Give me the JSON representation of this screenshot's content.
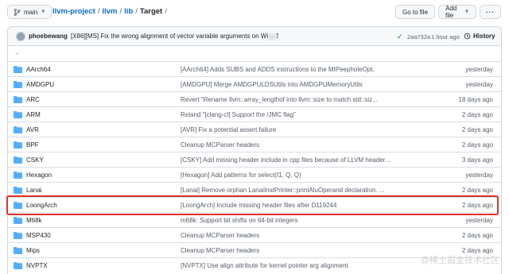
{
  "branch": {
    "label": "main"
  },
  "breadcrumb": {
    "repo": "llvm-project",
    "dir1": "llvm",
    "dir2": "lib",
    "current": "Target",
    "sep": "/"
  },
  "toolbar": {
    "goto_label": "Go to file",
    "add_label": "Add file",
    "more_label": "···"
  },
  "commit": {
    "author": "phoebewang",
    "message": "[X86][MS] Fix the wrong alignment of vector variable arguments on Win32",
    "ellipsis": "...",
    "check": "✓",
    "sha": "2aa732a",
    "time": "1 hour ago",
    "history_label": "History"
  },
  "parent": "..",
  "rows": [
    {
      "name": "AArch64",
      "message": "[AArch64] Adds SUBS and ADDS instructions to the MIPeepholeOpt.",
      "age": "yesterday"
    },
    {
      "name": "AMDGPU",
      "message": "[AMDGPU] Merge AMDGPULDSUtils into AMDGPUMemoryUtils",
      "age": "yesterday"
    },
    {
      "name": "ARC",
      "message": "Revert \"Rename llvm::array_lengthof into llvm::size to match std::siz...",
      "age": "18 days ago"
    },
    {
      "name": "ARM",
      "message": "Reland \"[clang-cl] Support the /JMC flag\"",
      "age": "2 days ago"
    },
    {
      "name": "AVR",
      "message": "[AVR] Fix a potential assert failure",
      "age": "2 days ago"
    },
    {
      "name": "BPF",
      "message": "Cleanup MCParser headers",
      "age": "2 days ago"
    },
    {
      "name": "CSKY",
      "message": "[CSKY] Add missing header include in cpp files because of LLVM header...",
      "age": "3 days ago"
    },
    {
      "name": "Hexagon",
      "message": "[Hexagon] Add patterns for select(I1, Q, Q)",
      "age": "yesterday"
    },
    {
      "name": "Lanai",
      "message": "[Lanai] Remove orphan LanaiInstPrinter::printAluOperand declaration. ...",
      "age": "2 days ago"
    },
    {
      "name": "LoongArch",
      "message": "[LoongArch] Include missing header files after D119244",
      "age": "2 days ago"
    },
    {
      "name": "M68k",
      "message": "m68k: Support bit shifts on 64-bit integers",
      "age": "yesterday"
    },
    {
      "name": "MSP430",
      "message": "Cleanup MCParser headers",
      "age": "2 days ago"
    },
    {
      "name": "Mips",
      "message": "Cleanup MCParser headers",
      "age": "2 days ago"
    },
    {
      "name": "NVPTX",
      "message": "[NVPTX] Use align attribute for kernel pointer arg alignment",
      "age": ""
    }
  ],
  "watermark": "@稀土掘金技术社区",
  "colors": {
    "link": "#0969da",
    "folder": "#54aeff",
    "highlight": "#e0302a",
    "check": "#1a7f37"
  }
}
